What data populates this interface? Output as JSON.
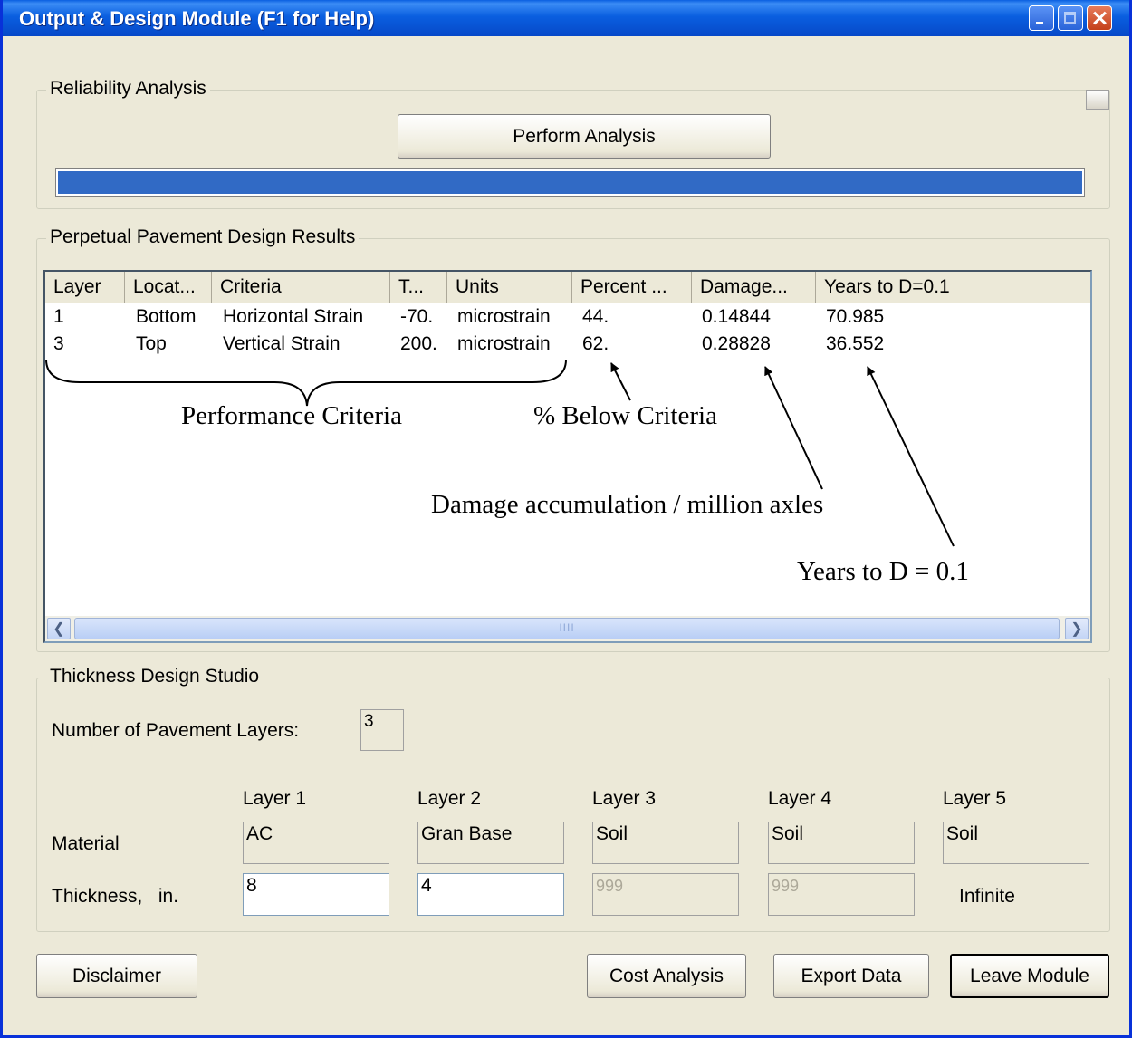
{
  "window": {
    "title": "Output & Design Module (F1 for Help)"
  },
  "reliability": {
    "group_label": "Reliability Analysis",
    "perform_button": "Perform Analysis",
    "progress_fraction": 1.0,
    "progress_color": "#316ac5"
  },
  "results": {
    "group_label": "Perpetual Pavement Design Results",
    "columns": [
      "Layer",
      "Locat...",
      "Criteria",
      "T...",
      "Units",
      "Percent ...",
      "Damage...",
      "Years to D=0.1"
    ],
    "rows": [
      [
        "1",
        "Bottom",
        "Horizontal Strain",
        "-70.",
        "microstrain",
        "44.",
        "0.14844",
        "70.985"
      ],
      [
        "3",
        "Top",
        "Vertical Strain",
        "200.",
        "microstrain",
        "62.",
        "0.28828",
        "36.552"
      ]
    ],
    "scroll_grip": "IIII",
    "annotations": {
      "performance": "Performance Criteria",
      "percent_below": "% Below Criteria",
      "damage": "Damage accumulation / million axles",
      "years": "Years to D = 0.1"
    }
  },
  "thickness": {
    "group_label": "Thickness Design Studio",
    "num_layers_label": "Number of Pavement Layers:",
    "num_layers_value": "3",
    "material_label": "Material",
    "thickness_label": "Thickness,   in.",
    "layers": [
      {
        "name": "Layer 1",
        "material": "AC",
        "thickness": "8"
      },
      {
        "name": "Layer 2",
        "material": "Gran Base",
        "thickness": "4"
      },
      {
        "name": "Layer 3",
        "material": "Soil",
        "thickness": "999"
      },
      {
        "name": "Layer 4",
        "material": "Soil",
        "thickness": "999"
      },
      {
        "name": "Layer 5",
        "material": "Soil",
        "thickness": "Infinite"
      }
    ]
  },
  "buttons": {
    "disclaimer": "Disclaimer",
    "cost": "Cost Analysis",
    "export": "Export Data",
    "leave": "Leave Module"
  }
}
